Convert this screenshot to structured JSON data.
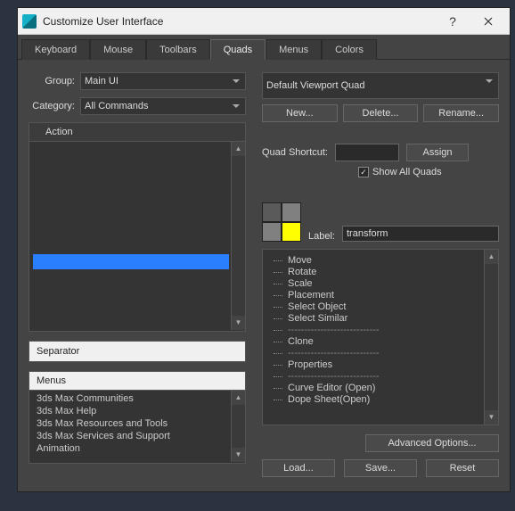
{
  "window": {
    "title": "Customize User Interface"
  },
  "tabs": [
    "Keyboard",
    "Mouse",
    "Toolbars",
    "Quads",
    "Menus",
    "Colors"
  ],
  "active_tab": "Quads",
  "left": {
    "group_label": "Group:",
    "group_value": "Main UI",
    "category_label": "Category:",
    "category_value": "All Commands",
    "action_header": "Action",
    "separator_label": "Separator",
    "menus_header": "Menus",
    "menus_items": [
      "3ds Max Communities",
      "3ds Max Help",
      "3ds Max Resources and Tools",
      "3ds Max Services and Support",
      "Animation"
    ]
  },
  "right": {
    "quad_value": "Default Viewport Quad",
    "new_btn": "New...",
    "delete_btn": "Delete...",
    "rename_btn": "Rename...",
    "quad_shortcut_label": "Quad Shortcut:",
    "assign_btn": "Assign",
    "show_all_label": "Show All Quads",
    "show_all_checked": true,
    "label_label": "Label:",
    "label_value": "transform",
    "swatches": [
      "#5a5a5a",
      "#808080",
      "#808080",
      "#ffff00"
    ],
    "tree": [
      "Move",
      "Rotate",
      "Scale",
      "Placement",
      "Select Object",
      "Select Similar",
      "----------------------------",
      "Clone",
      "----------------------------",
      "Properties",
      "----------------------------",
      "Curve Editor (Open)",
      "Dope Sheet(Open)"
    ],
    "advanced_btn": "Advanced Options...",
    "load_btn": "Load...",
    "save_btn": "Save...",
    "reset_btn": "Reset"
  }
}
